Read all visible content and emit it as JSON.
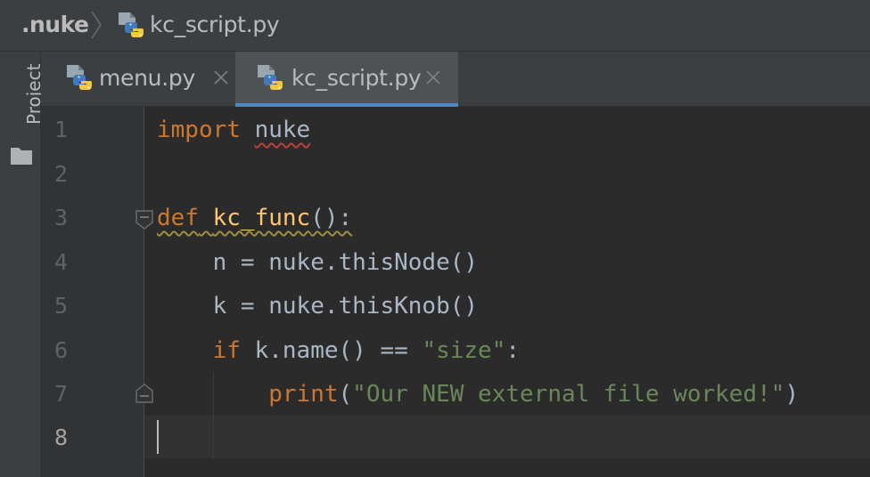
{
  "breadcrumb": {
    "root": ".nuke",
    "file": "kc_script.py"
  },
  "sidebar": {
    "project_label": "Project"
  },
  "tabs": [
    {
      "label": "menu.py",
      "active": false
    },
    {
      "label": "kc_script.py",
      "active": true
    }
  ],
  "editor": {
    "line_numbers": [
      "1",
      "2",
      "3",
      "4",
      "5",
      "6",
      "7",
      "8"
    ],
    "current_line": "8",
    "lines": {
      "l1": {
        "kw": "import",
        "mod": "nuke"
      },
      "l3": {
        "kw": "def",
        "fn": "kc_func",
        "rest": "():"
      },
      "l4": {
        "text": "n = nuke.thisNode()"
      },
      "l5": {
        "text": "k = nuke.thisKnob()"
      },
      "l6": {
        "kw": "if",
        "mid": " k.name() == ",
        "str": "\"size\"",
        "end": ":"
      },
      "l7": {
        "fn": "print",
        "open": "(",
        "str": "\"Our NEW external file worked!\"",
        "close": ")"
      }
    }
  },
  "colors": {
    "accent": "#4a88c7",
    "keyword": "#cc7832",
    "function": "#ffc66d",
    "string": "#6a8759",
    "text": "#a9b7c6"
  },
  "icons": {
    "file": "python-file-icon",
    "close": "close-icon",
    "folder": "folder-icon",
    "separator": "chevron-right-icon"
  }
}
